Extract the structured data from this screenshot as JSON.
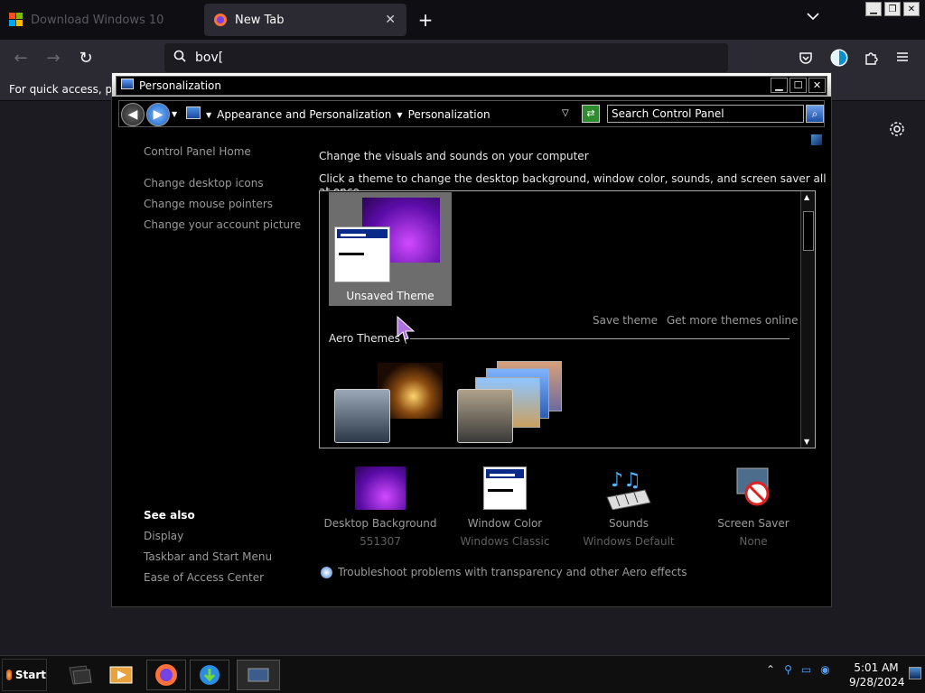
{
  "browser": {
    "tabs": [
      {
        "label": "Download Windows 10",
        "active": false
      },
      {
        "label": "New Tab",
        "active": true
      }
    ],
    "new_tab_symbol": "+",
    "url_text": "bov[",
    "bookmarks_text": "For quick access, plac"
  },
  "window": {
    "title": "Personalization",
    "breadcrumb": [
      "Appearance and Personalization",
      "Personalization"
    ],
    "search_placeholder": "Search Control Panel"
  },
  "sidebar": {
    "home": "Control Panel Home",
    "links": [
      "Change desktop icons",
      "Change mouse pointers",
      "Change your account picture"
    ],
    "see_also_title": "See also",
    "see_also": [
      "Display",
      "Taskbar and Start Menu",
      "Ease of Access Center"
    ]
  },
  "main": {
    "heading": "Change the visuals and sounds on your computer",
    "subheading": "Click a theme to change the desktop background, window color, sounds, and screen saver all at once.",
    "unsaved_theme": "Unsaved Theme",
    "save_theme": "Save theme",
    "get_more": "Get more themes online",
    "aero_header": "Aero Themes (",
    "settings": [
      {
        "label": "Desktop Background",
        "value": "551307"
      },
      {
        "label": "Window Color",
        "value": "Windows Classic"
      },
      {
        "label": "Sounds",
        "value": "Windows Default"
      },
      {
        "label": "Screen Saver",
        "value": "None"
      }
    ],
    "troubleshoot": "Troubleshoot problems with transparency and other Aero effects"
  },
  "taskbar": {
    "start": "Start",
    "time": "5:01 AM",
    "date": "9/28/2024"
  },
  "colors": {
    "browser_bg": "#1c1b22",
    "toolbar": "#2b2a33",
    "window_bg": "#000000",
    "link_gray": "#9a9a9a",
    "purple": "#9b2cf0"
  }
}
